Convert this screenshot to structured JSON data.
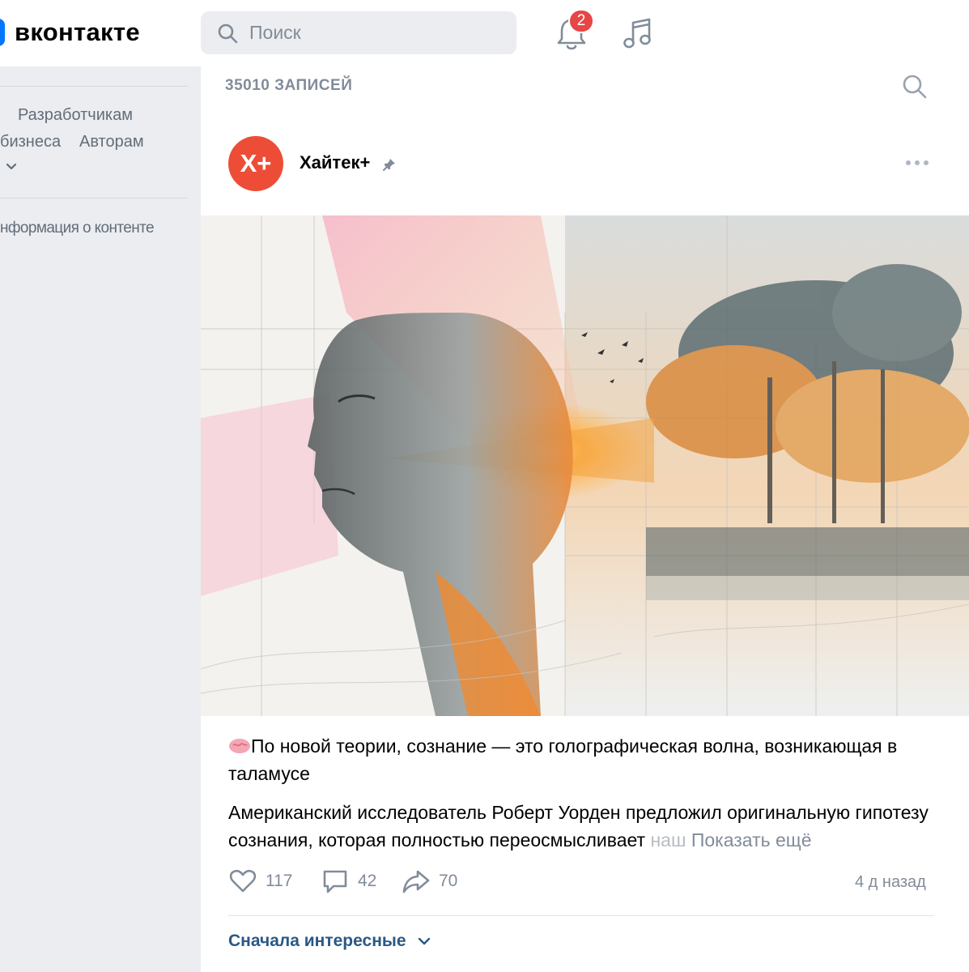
{
  "header": {
    "logo_text": "вконтакте",
    "search_placeholder": "Поиск",
    "notifications_count": "2"
  },
  "sidebar": {
    "links": [
      "Разработчикам",
      "бизнеса",
      "Авторам",
      "нформация о контенте"
    ]
  },
  "feed": {
    "records_count": "35010 ЗАПИСЕЙ"
  },
  "post": {
    "avatar_text": "Х+",
    "author": "Хайтек+",
    "title": "По новой теории, сознание — это голографическая волна, возникающая в таламусе",
    "body": "Американский исследователь Роберт Уорден предложил оригинальную гипотезу сознания, которая полностью переосмысливает наш",
    "body_fade": "наш",
    "show_more": "Показать ещё",
    "likes": "117",
    "comments": "42",
    "shares": "70",
    "time": "4 д назад",
    "sort_label": "Сначала интересные"
  },
  "colors": {
    "brand": "#0077ff",
    "avatar": "#ed4d37",
    "badge": "#e64646",
    "link": "#2a5885"
  }
}
